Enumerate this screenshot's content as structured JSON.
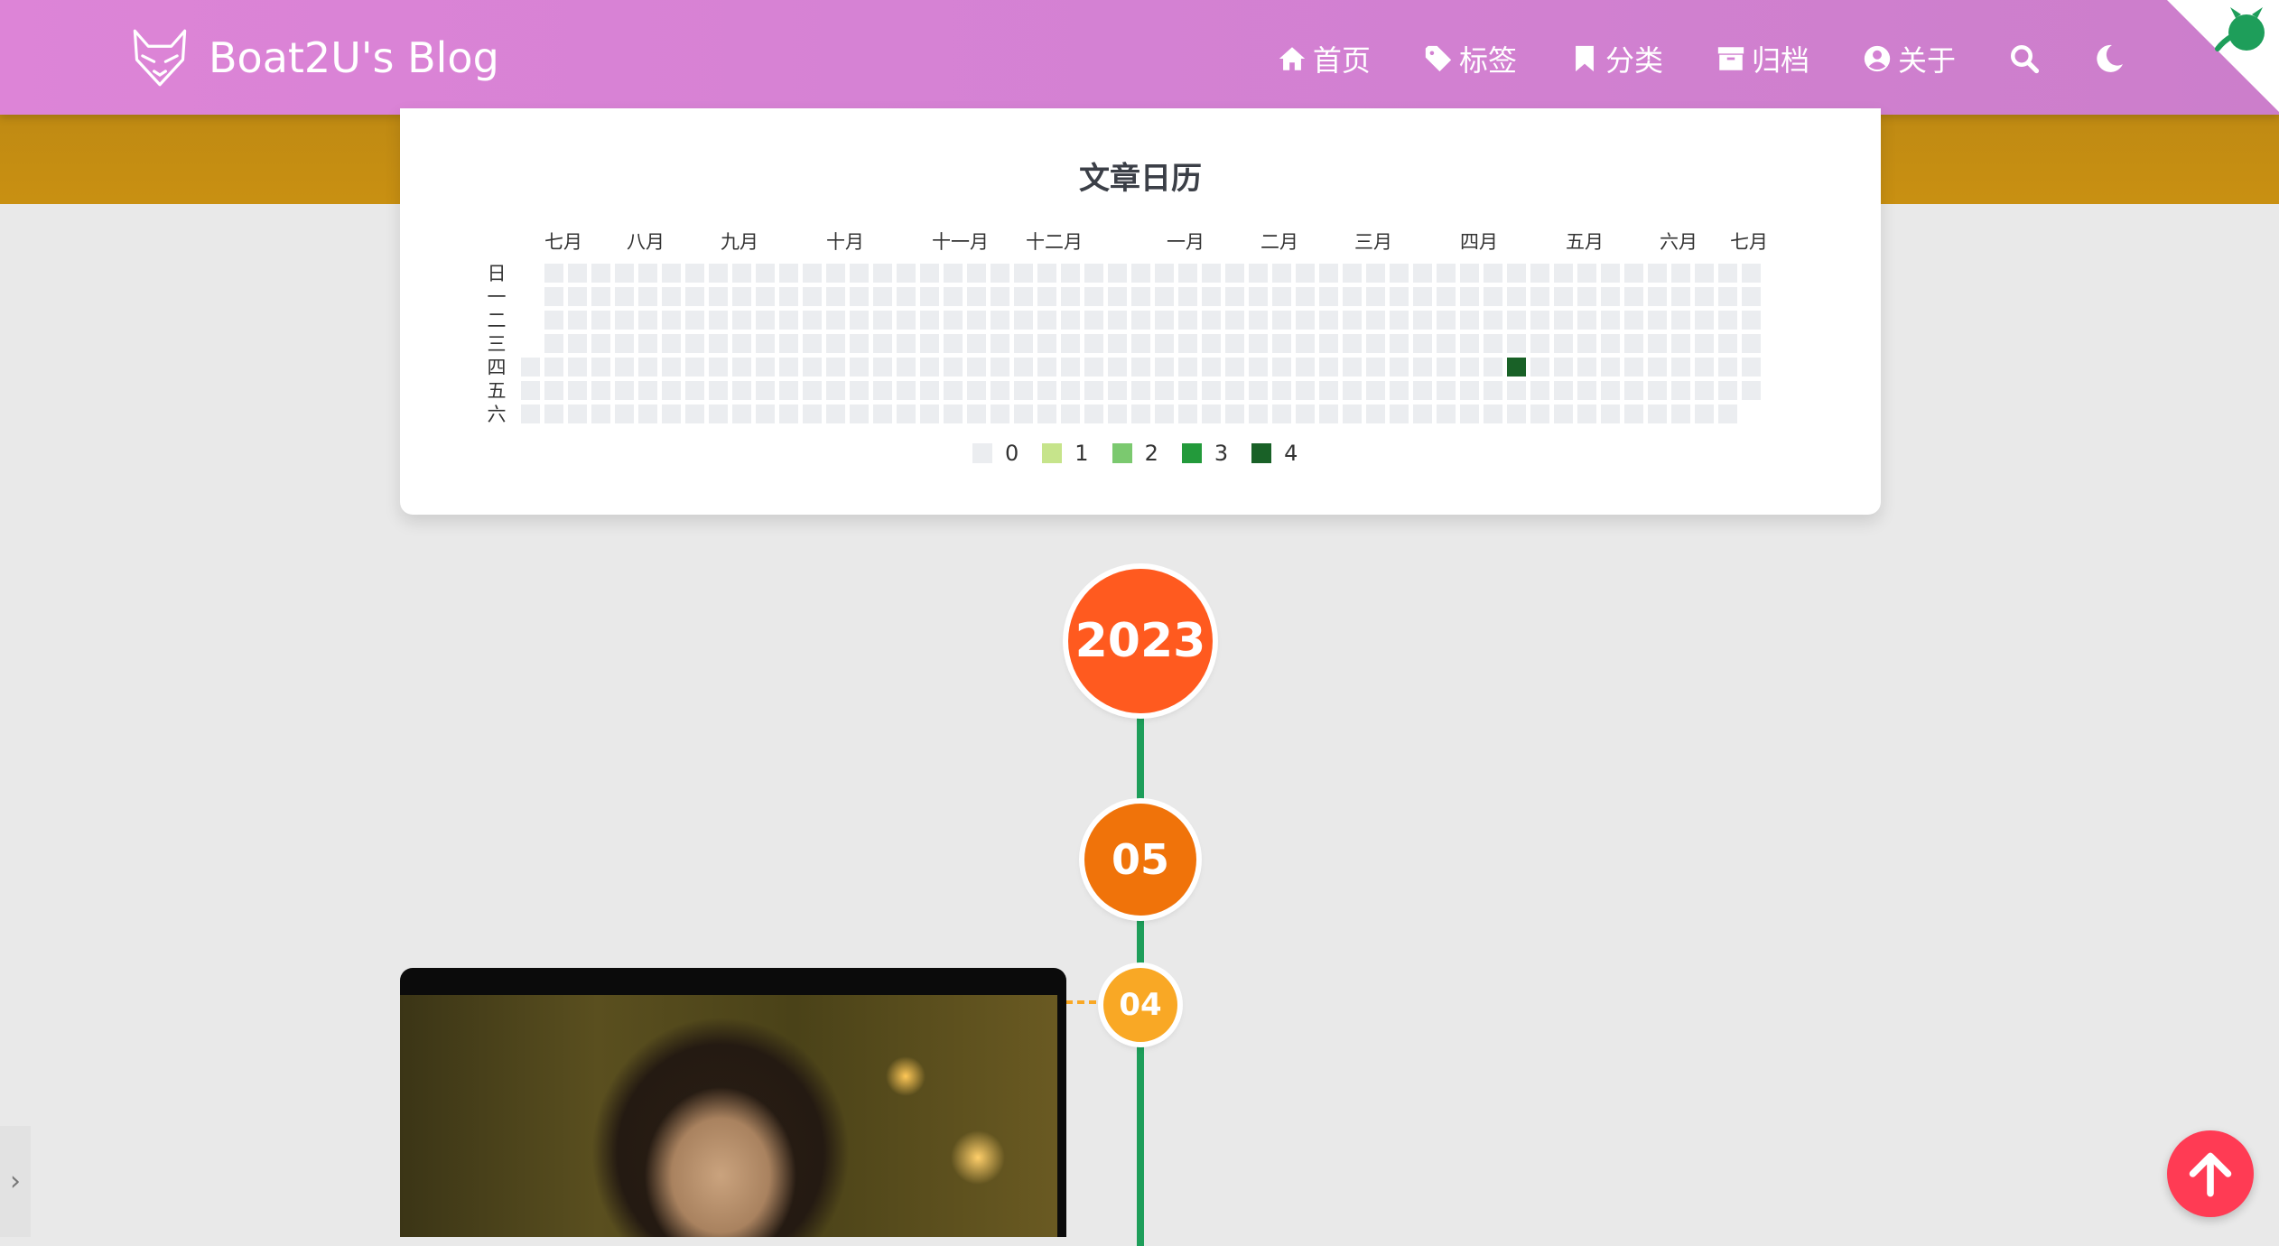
{
  "site": {
    "brand_title": "Boat2U's Blog"
  },
  "nav": {
    "items": [
      {
        "label": "首页",
        "icon": "home-icon"
      },
      {
        "label": "标签",
        "icon": "tag-icon"
      },
      {
        "label": "分类",
        "icon": "bookmark-icon"
      },
      {
        "label": "归档",
        "icon": "archive-icon"
      },
      {
        "label": "关于",
        "icon": "user-circle-icon"
      }
    ],
    "search_icon": "search-icon",
    "theme_icon": "moon-icon"
  },
  "calendar": {
    "title": "文章日历",
    "months": [
      "七月",
      "八月",
      "九月",
      "十月",
      "十一月",
      "十二月",
      "一月",
      "二月",
      "三月",
      "四月",
      "五月",
      "六月",
      "七月"
    ],
    "weekdays": [
      "日",
      "一",
      "二",
      "三",
      "四",
      "五",
      "六"
    ],
    "legend": [
      "0",
      "1",
      "2",
      "3",
      "4"
    ],
    "colors": [
      "#ebedf0",
      "#c6e48b",
      "#7bc96f",
      "#239a3b",
      "#196127"
    ],
    "active_cell": {
      "week": 42,
      "day": 4,
      "level": 4
    }
  },
  "timeline": {
    "year": "2023",
    "month": "05",
    "day": "04"
  },
  "colors": {
    "navbar": "#d882d5",
    "timeline_line": "#1e9e5a",
    "year_bubble": "#ff5a1f",
    "month_bubble": "#f0730a",
    "day_bubble": "#f9a825",
    "back_to_top": "#ff3b54"
  }
}
